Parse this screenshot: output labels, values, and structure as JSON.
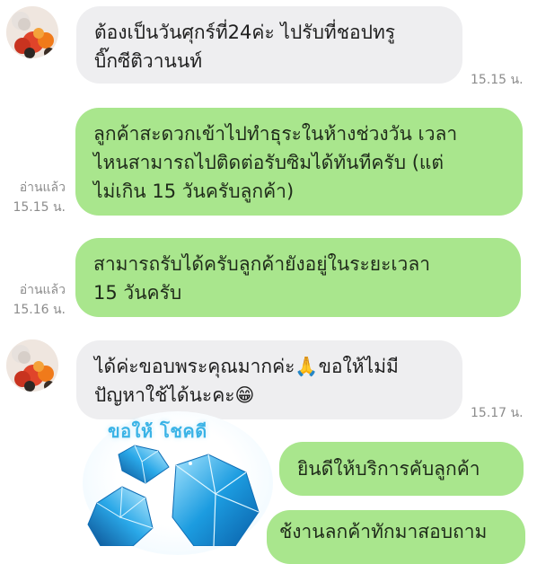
{
  "messages": [
    {
      "id": "m1",
      "side": "in",
      "lines": "ต้องเป็นวันศุกร์ที่24ค่ะ ไปรับที่ชอปทรู\nบิ๊กซีติวานนท์",
      "time": "15.15 น."
    },
    {
      "id": "m2",
      "side": "out",
      "lines": "ลูกค้าสะดวกเข้าไปทำธุระในห้างช่วงวัน เวลา\nไหนสามารถไปติดต่อรับซิมได้ทันทีครับ (แต่\nไม่เกิน 15 วันครับลูกค้า)",
      "read": "อ่านแล้ว",
      "time": "15.15 น."
    },
    {
      "id": "m3",
      "side": "out",
      "lines": "สามารถรับได้ครับลูกค้ายังอยู่ในระยะเวลา\n15 วันครับ",
      "read": "อ่านแล้ว",
      "time": "15.16 น."
    },
    {
      "id": "m4",
      "side": "in",
      "lines": "ได้ค่ะขอบพระคุณมากค่ะ🙏ขอให้ไม่มี\nปัญหาใช้ได้นะคะ😁",
      "time": "15.17 น."
    },
    {
      "id": "m5",
      "side": "out",
      "lines": "ยินดีให้บริการคับลูกค้า"
    },
    {
      "id": "m6",
      "side": "out",
      "lines": "ช้งานลกค้าทักมาสอบถาม"
    }
  ],
  "sticker": {
    "text": "ขอให้ โชคดี",
    "icon": "blue-diamond-sticker"
  },
  "colors": {
    "incoming": "#eeeef0",
    "outgoing": "#a9e68d",
    "time": "#8c8c8c",
    "sticker_text": "#3ab3e6"
  }
}
